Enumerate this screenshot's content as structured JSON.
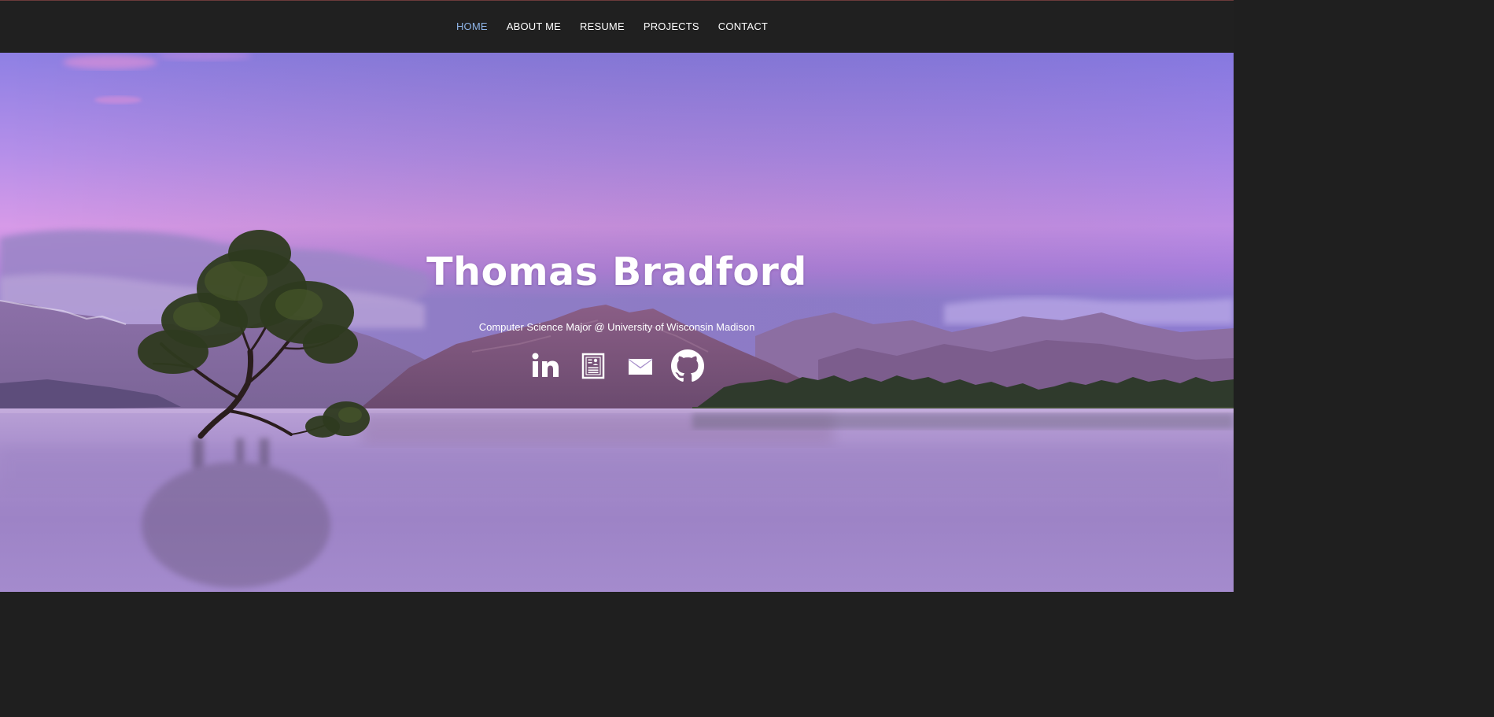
{
  "nav": {
    "items": [
      {
        "label": "HOME",
        "active": true
      },
      {
        "label": "ABOUT ME",
        "active": false
      },
      {
        "label": "RESUME",
        "active": false
      },
      {
        "label": "PROJECTS",
        "active": false
      },
      {
        "label": "CONTACT",
        "active": false
      }
    ],
    "active_color": "#8fb5e8",
    "text_color": "#ffffff",
    "background": "#202020"
  },
  "hero": {
    "name": "Thomas Bradford",
    "subtitle": "Computer Science Major @ University of Wisconsin Madison",
    "social": [
      {
        "icon": "linkedin-icon"
      },
      {
        "icon": "resume-document-icon"
      },
      {
        "icon": "email-envelope-icon"
      },
      {
        "icon": "github-icon"
      }
    ],
    "background_image": "purple lake landscape with lone tree"
  }
}
